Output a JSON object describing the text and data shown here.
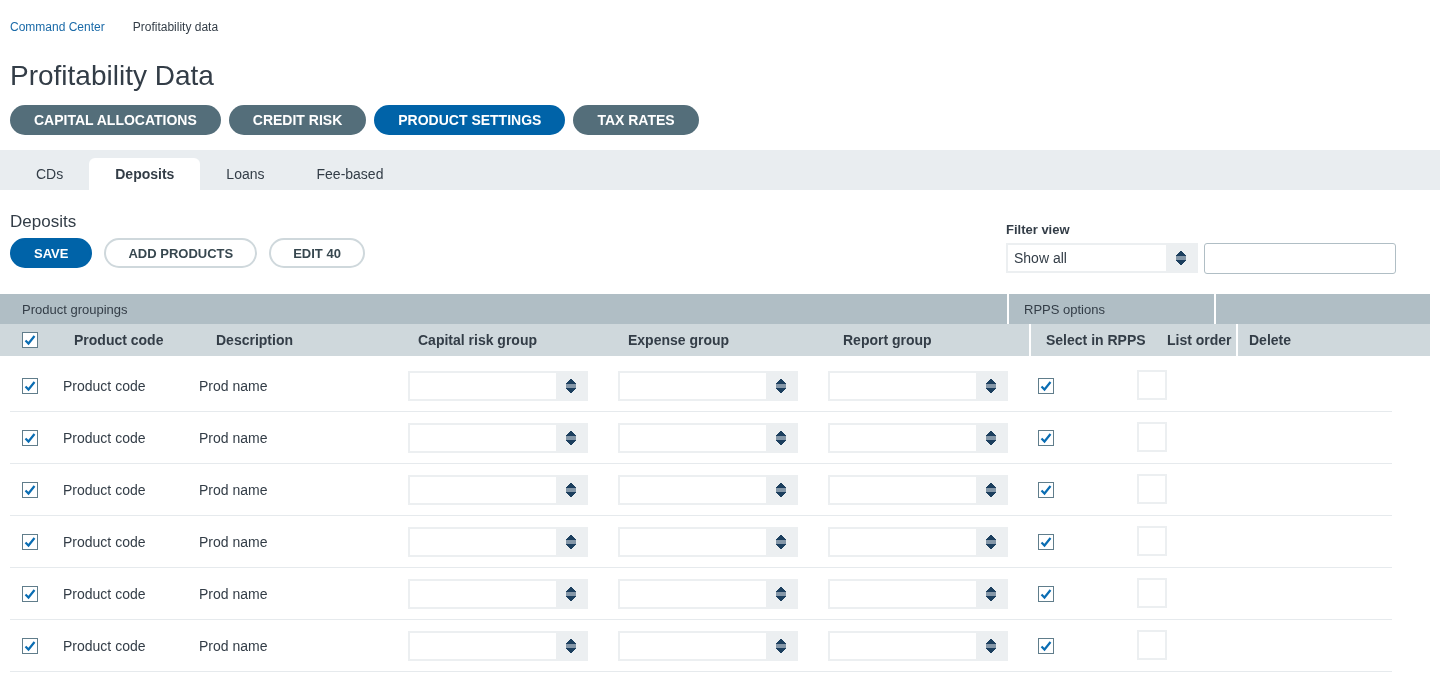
{
  "breadcrumb": [
    {
      "label": "Command Center",
      "kind": "link"
    },
    {
      "label": "Profitability data",
      "kind": "current"
    }
  ],
  "title": "Profitability Data",
  "nav_buttons": [
    {
      "label": "CAPITAL ALLOCATIONS",
      "selected": false
    },
    {
      "label": "CREDIT RISK",
      "selected": false
    },
    {
      "label": "PRODUCT SETTINGS",
      "selected": true
    },
    {
      "label": "TAX RATES",
      "selected": false
    }
  ],
  "tabs": [
    {
      "label": "CDs",
      "selected": false
    },
    {
      "label": "Deposits",
      "selected": true
    },
    {
      "label": "Loans",
      "selected": false
    },
    {
      "label": "Fee-based",
      "selected": false
    }
  ],
  "section_title": "Deposits",
  "actions": [
    {
      "label": "SAVE",
      "kind": "primary"
    },
    {
      "label": "ADD PRODUCTS",
      "kind": "outline"
    },
    {
      "label": "EDIT 40",
      "kind": "outline"
    }
  ],
  "filter": {
    "label": "Filter view",
    "value": "Show all"
  },
  "table": {
    "groups": [
      "Product groupings",
      "RPPS options"
    ],
    "select_all_checked": true,
    "columns": [
      "Product code",
      "Description",
      "Capital risk group",
      "Expense group",
      "Report group",
      "Select in RPPS",
      "List order",
      "Delete"
    ],
    "rows": [
      {
        "checked": true,
        "product_code": "Product code",
        "description": "Prod name",
        "select_in_rpps": true
      },
      {
        "checked": true,
        "product_code": "Product code",
        "description": "Prod name",
        "select_in_rpps": true
      },
      {
        "checked": true,
        "product_code": "Product code",
        "description": "Prod name",
        "select_in_rpps": true
      },
      {
        "checked": true,
        "product_code": "Product code",
        "description": "Prod name",
        "select_in_rpps": true
      },
      {
        "checked": true,
        "product_code": "Product code",
        "description": "Prod name",
        "select_in_rpps": true
      },
      {
        "checked": true,
        "product_code": "Product code",
        "description": "Prod name",
        "select_in_rpps": true
      }
    ]
  }
}
